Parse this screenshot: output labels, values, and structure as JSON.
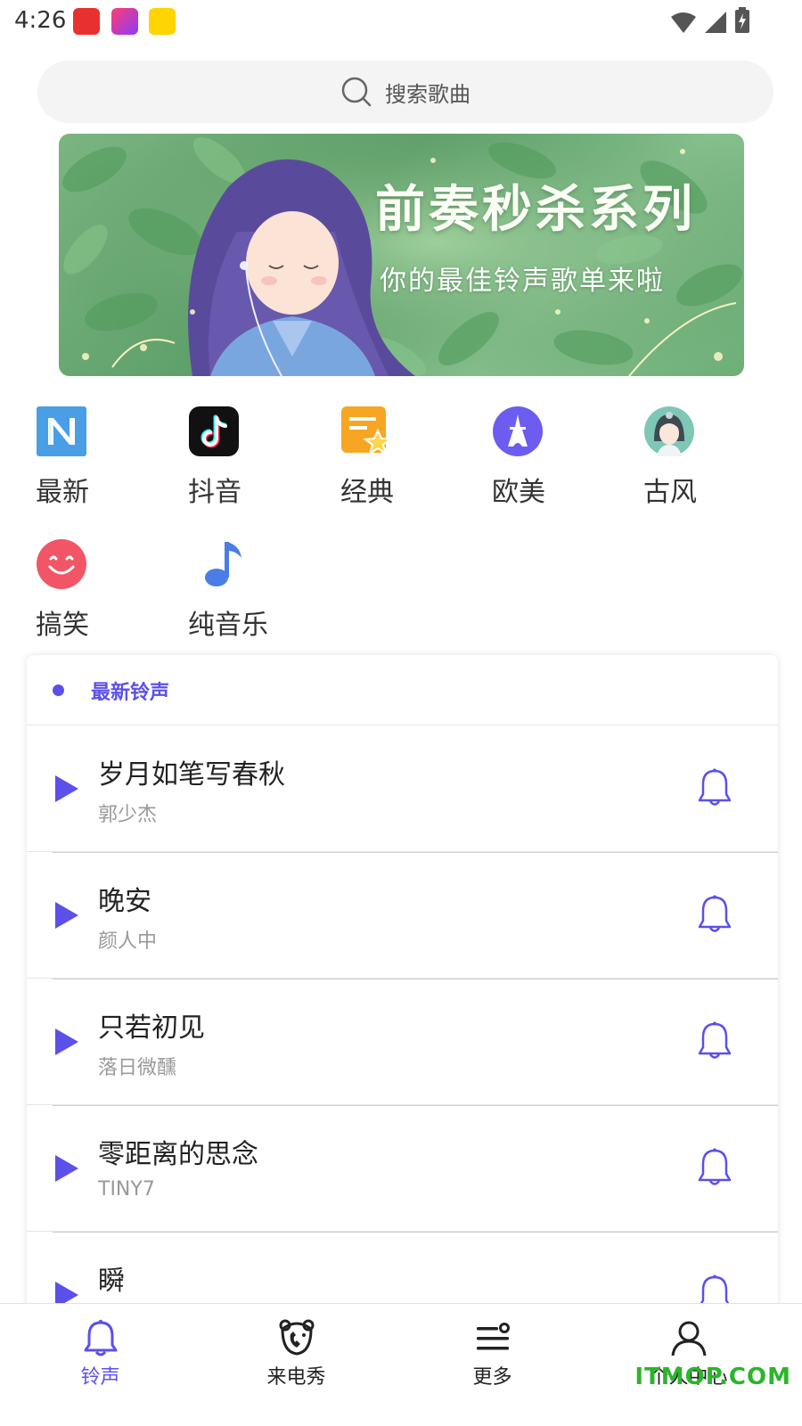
{
  "status_bar": {
    "time": "4:26",
    "app_icons": [
      "kuaishou-icon",
      "phone-show-icon",
      "qimao-icon"
    ],
    "right_icons": [
      "wifi-icon",
      "signal-icon",
      "battery-charging-icon"
    ]
  },
  "search": {
    "placeholder": "搜索歌曲",
    "icon": "search-icon"
  },
  "banner": {
    "title": "前奏秒杀系列",
    "subtitle": "你的最佳铃声歌单来啦"
  },
  "categories": [
    {
      "label": "最新",
      "icon": "new-icon",
      "color": "#4a9ee6"
    },
    {
      "label": "抖音",
      "icon": "douyin-icon",
      "color": "#111111"
    },
    {
      "label": "经典",
      "icon": "classic-star-icon",
      "color": "#f6a623"
    },
    {
      "label": "欧美",
      "icon": "eiffel-tower-icon",
      "color": "#6d5cf0"
    },
    {
      "label": "古风",
      "icon": "ancient-girl-icon",
      "color": "#7ec6b5"
    },
    {
      "label": "搞笑",
      "icon": "smile-icon",
      "color": "#f25666"
    },
    {
      "label": "纯音乐",
      "icon": "music-note-icon",
      "color": "#4a7de6"
    }
  ],
  "list": {
    "title": "最新铃声",
    "items": [
      {
        "title": "岁月如笔写春秋",
        "artist": "郭少杰"
      },
      {
        "title": "晚安",
        "artist": "颜人中"
      },
      {
        "title": "只若初见",
        "artist": "落日微醺"
      },
      {
        "title": "零距离的思念",
        "artist": "TINY7"
      },
      {
        "title": "瞬",
        "artist": ""
      }
    ]
  },
  "bottom_nav": {
    "items": [
      {
        "label": "铃声",
        "icon": "bell-icon",
        "active": true
      },
      {
        "label": "来电秀",
        "icon": "phone-bear-icon",
        "active": false
      },
      {
        "label": "更多",
        "icon": "menu-icon",
        "active": false
      },
      {
        "label": "个人中心",
        "icon": "user-icon",
        "active": false
      }
    ]
  },
  "watermark": "ITMOP.COM",
  "colors": {
    "accent": "#5b50ea",
    "text_primary": "#222222",
    "text_secondary": "#999999"
  }
}
